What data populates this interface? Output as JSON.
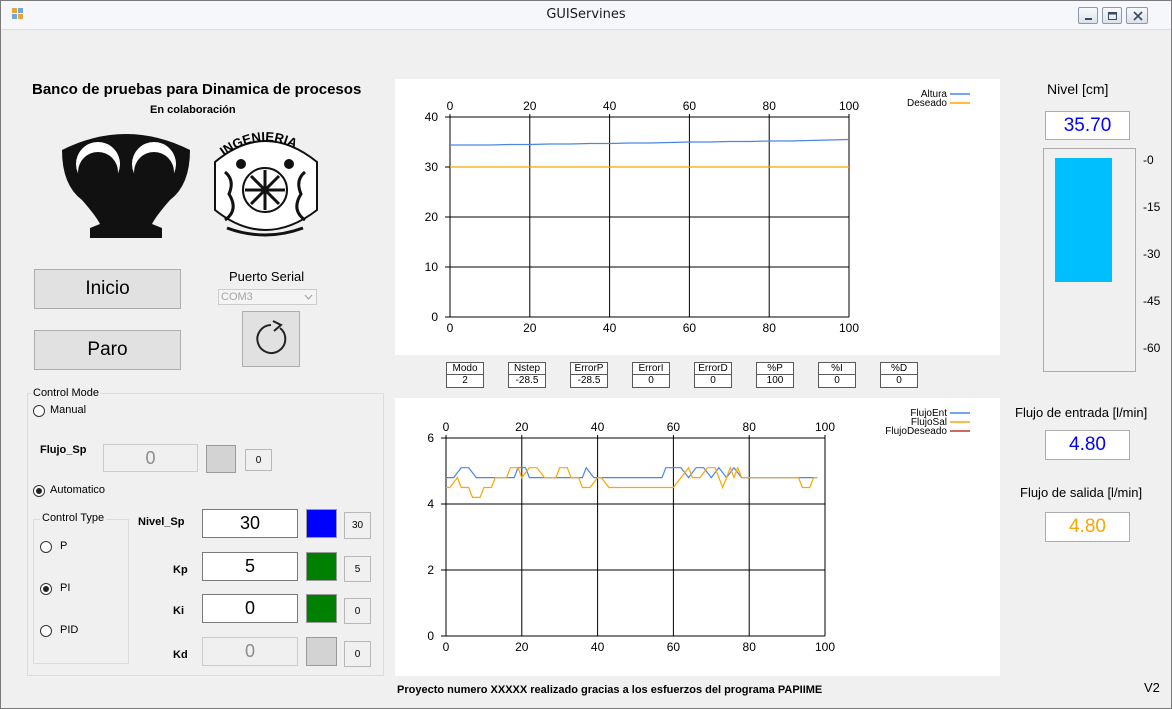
{
  "window": {
    "title": "GUIServines"
  },
  "header": {
    "title": "Banco de pruebas para Dinamica de procesos",
    "subtitle": "En colaboración",
    "logo2_text": "INGENIERIA"
  },
  "buttons": {
    "start": "Inicio",
    "stop": "Paro"
  },
  "serial": {
    "label": "Puerto Serial",
    "port": "COM3"
  },
  "control_mode": {
    "title": "Control Mode",
    "manual": "Manual",
    "automatico": "Automatico",
    "selected": "Automatico"
  },
  "flujo_sp": {
    "label": "Flujo_Sp",
    "value": "0",
    "indicator": "0"
  },
  "control_type": {
    "title": "Control Type",
    "p": "P",
    "pi": "PI",
    "pid": "PID",
    "selected": "PI"
  },
  "fields": {
    "nivel_sp": {
      "label": "Nivel_Sp",
      "value": "30",
      "indicator": "30",
      "color": "#0000ff"
    },
    "kp": {
      "label": "Kp",
      "value": "5",
      "indicator": "5",
      "color": "#008000"
    },
    "ki": {
      "label": "Ki",
      "value": "0",
      "indicator": "0",
      "color": "#008000"
    },
    "kd": {
      "label": "Kd",
      "value": "0",
      "indicator": "0",
      "color": "#d3d3d3"
    }
  },
  "params": [
    {
      "h": "Modo",
      "v": "2"
    },
    {
      "h": "Nstep",
      "v": "-28.5"
    },
    {
      "h": "ErrorP",
      "v": "-28.5"
    },
    {
      "h": "ErrorI",
      "v": "0"
    },
    {
      "h": "ErrorD",
      "v": "0"
    },
    {
      "h": "%P",
      "v": "100"
    },
    {
      "h": "%I",
      "v": "0"
    },
    {
      "h": "%D",
      "v": "0"
    }
  ],
  "nivel": {
    "label": "Nivel [cm]",
    "value": "35.70",
    "ticks": [
      "-0",
      "-15",
      "-30",
      "-45",
      "-60"
    ],
    "fill_fraction": 0.6,
    "bar_color": "#00bfff"
  },
  "flujo_entrada": {
    "label": "Flujo de entrada [l/min]",
    "value": "4.80",
    "color": "#0000ff"
  },
  "flujo_salida": {
    "label": "Flujo de salida [l/min]",
    "value": "4.80",
    "color": "#ffa500"
  },
  "footer": {
    "text": "Proyecto numero XXXXX realizado gracias a los esfuerzos del programa PAPIIME",
    "version": "V2"
  },
  "chart_data": [
    {
      "type": "line",
      "xlim": [
        0,
        100
      ],
      "ylim": [
        0,
        40
      ],
      "xticks": [
        "0",
        "20",
        "40",
        "60",
        "80",
        "100"
      ],
      "yticks": [
        "0",
        "10",
        "20",
        "30",
        "40"
      ],
      "grid": true,
      "legend_position": "top-right",
      "series": [
        {
          "name": "Altura",
          "color": "#4a86e8",
          "x": [
            0,
            5,
            10,
            15,
            20,
            25,
            30,
            35,
            40,
            45,
            50,
            55,
            60,
            65,
            70,
            75,
            80,
            85,
            90,
            95,
            100
          ],
          "y": [
            34.4,
            34.4,
            34.4,
            34.5,
            34.5,
            34.6,
            34.6,
            34.7,
            34.7,
            34.8,
            34.8,
            34.9,
            35.0,
            35.0,
            35.1,
            35.1,
            35.2,
            35.2,
            35.3,
            35.4,
            35.5
          ]
        },
        {
          "name": "Deseado",
          "color": "#ffa500",
          "x": [
            0,
            100
          ],
          "y": [
            30,
            30
          ]
        }
      ]
    },
    {
      "type": "line",
      "xlim": [
        0,
        100
      ],
      "ylim": [
        0,
        6
      ],
      "xticks": [
        "0",
        "20",
        "40",
        "60",
        "80",
        "100"
      ],
      "yticks": [
        "0",
        "2",
        "4",
        "6"
      ],
      "grid": true,
      "legend_position": "top-right",
      "series": [
        {
          "name": "FlujoEnt",
          "color": "#4a86e8",
          "x": [
            0,
            2,
            4,
            6,
            8,
            10,
            15,
            18,
            19,
            21,
            22,
            25,
            30,
            36,
            37,
            39,
            40,
            45,
            50,
            55,
            57,
            58,
            62,
            64,
            66,
            68,
            70,
            72,
            74,
            76,
            78,
            80,
            85,
            90,
            94,
            96,
            98
          ],
          "y": [
            4.8,
            4.8,
            5.1,
            5.1,
            4.8,
            4.8,
            4.8,
            4.8,
            5.1,
            5.1,
            4.8,
            4.8,
            4.8,
            4.8,
            5.1,
            4.8,
            4.8,
            4.8,
            4.8,
            4.8,
            4.8,
            5.1,
            5.1,
            4.8,
            5.1,
            5.1,
            4.8,
            5.1,
            4.8,
            5.1,
            4.8,
            4.8,
            4.8,
            4.8,
            4.8,
            4.8,
            4.8
          ]
        },
        {
          "name": "FlujoSal",
          "color": "#ffa500",
          "x": [
            0,
            1,
            3,
            4,
            6,
            7,
            9,
            10,
            12,
            13,
            16,
            17,
            19,
            20,
            22,
            24,
            26,
            29,
            30,
            32,
            33,
            35,
            36,
            38,
            40,
            41,
            43,
            50,
            55,
            58,
            60,
            62,
            64,
            65,
            67,
            69,
            71,
            72,
            73,
            74,
            75,
            76,
            77,
            78,
            80,
            85,
            90,
            93,
            94,
            96,
            97,
            98
          ],
          "y": [
            4.5,
            4.5,
            4.8,
            4.5,
            4.5,
            4.2,
            4.2,
            4.5,
            4.5,
            4.8,
            4.8,
            5.1,
            5.1,
            4.8,
            5.1,
            5.1,
            4.8,
            4.8,
            5.1,
            5.1,
            4.8,
            4.8,
            4.5,
            4.5,
            4.8,
            4.8,
            4.5,
            4.5,
            4.5,
            4.5,
            4.5,
            4.8,
            5.1,
            4.8,
            4.8,
            5.1,
            5.1,
            4.8,
            4.5,
            4.8,
            5.1,
            4.8,
            5.1,
            4.8,
            4.8,
            4.8,
            4.8,
            4.8,
            4.5,
            4.5,
            4.8,
            4.8
          ]
        },
        {
          "name": "FlujoDeseado",
          "color": "#c0392b",
          "x": [],
          "y": []
        }
      ]
    }
  ]
}
